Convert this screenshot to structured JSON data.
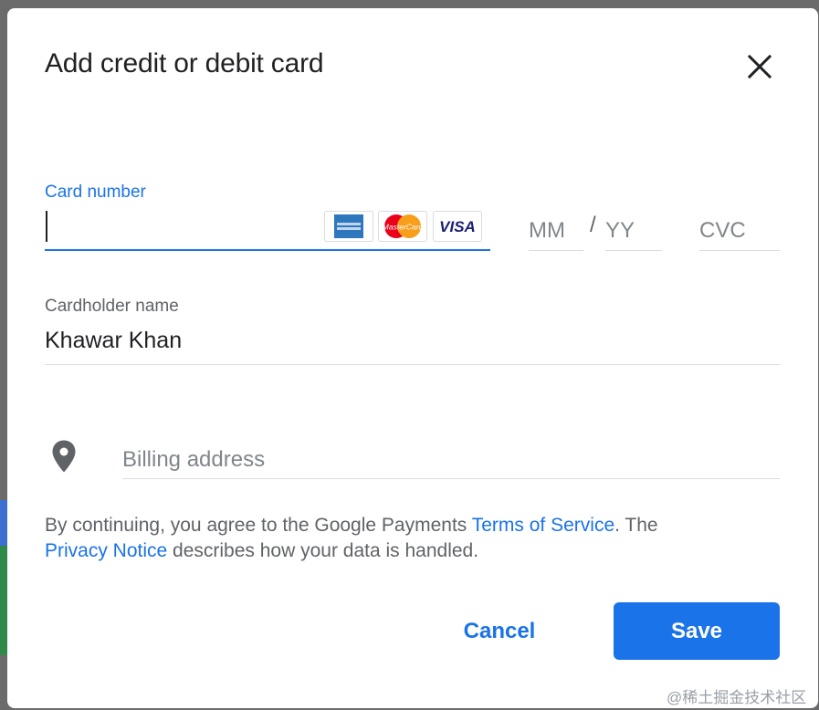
{
  "dialog": {
    "title": "Add credit or debit card",
    "close_icon": "close-icon"
  },
  "card": {
    "number_label": "Card number",
    "number_value": "",
    "logos": [
      "amex-logo",
      "mastercard-logo",
      "visa-logo"
    ],
    "mastercard_text": "MasterCard",
    "visa_text": "VISA",
    "month_placeholder": "MM",
    "separator": "/",
    "year_placeholder": "YY",
    "cvc_placeholder": "CVC"
  },
  "holder": {
    "label": "Cardholder name",
    "value": "Khawar Khan"
  },
  "billing": {
    "icon": "location-pin-icon",
    "placeholder": "Billing address"
  },
  "legal": {
    "text_before": "By continuing, you agree to the Google Payments ",
    "terms_link": "Terms of Service",
    "text_middle": ". The ",
    "privacy_link": "Privacy Notice",
    "text_after": " describes how your data is handled."
  },
  "actions": {
    "cancel_label": "Cancel",
    "save_label": "Save"
  },
  "watermark": "@稀土掘金技术社区",
  "colors": {
    "accent": "#1a73e8",
    "backdrop": "#6b6b6b",
    "text": "#202124",
    "muted": "#5f6368"
  }
}
